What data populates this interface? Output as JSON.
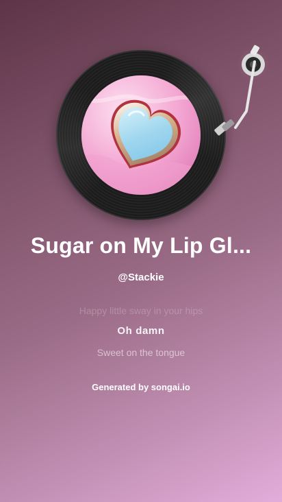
{
  "song": {
    "title": "Sugar on My Lip Gl...",
    "artist": "@Stackie",
    "cover_art": "pink-heart-cover"
  },
  "lyrics": {
    "previous": "Happy little sway in your hips",
    "current": "Oh damn",
    "next": "Sweet on the tongue"
  },
  "footer": {
    "credit": "Generated by songai.io"
  },
  "colors": {
    "background_start": "#5e3447",
    "background_end": "#e3addb",
    "record": "#1c1c1c",
    "label_pink": "#f4a9d3",
    "heart_blue": "#9fd6ee"
  },
  "icons": {
    "tonearm": "tonearm-icon",
    "vinyl": "vinyl-record-icon"
  }
}
